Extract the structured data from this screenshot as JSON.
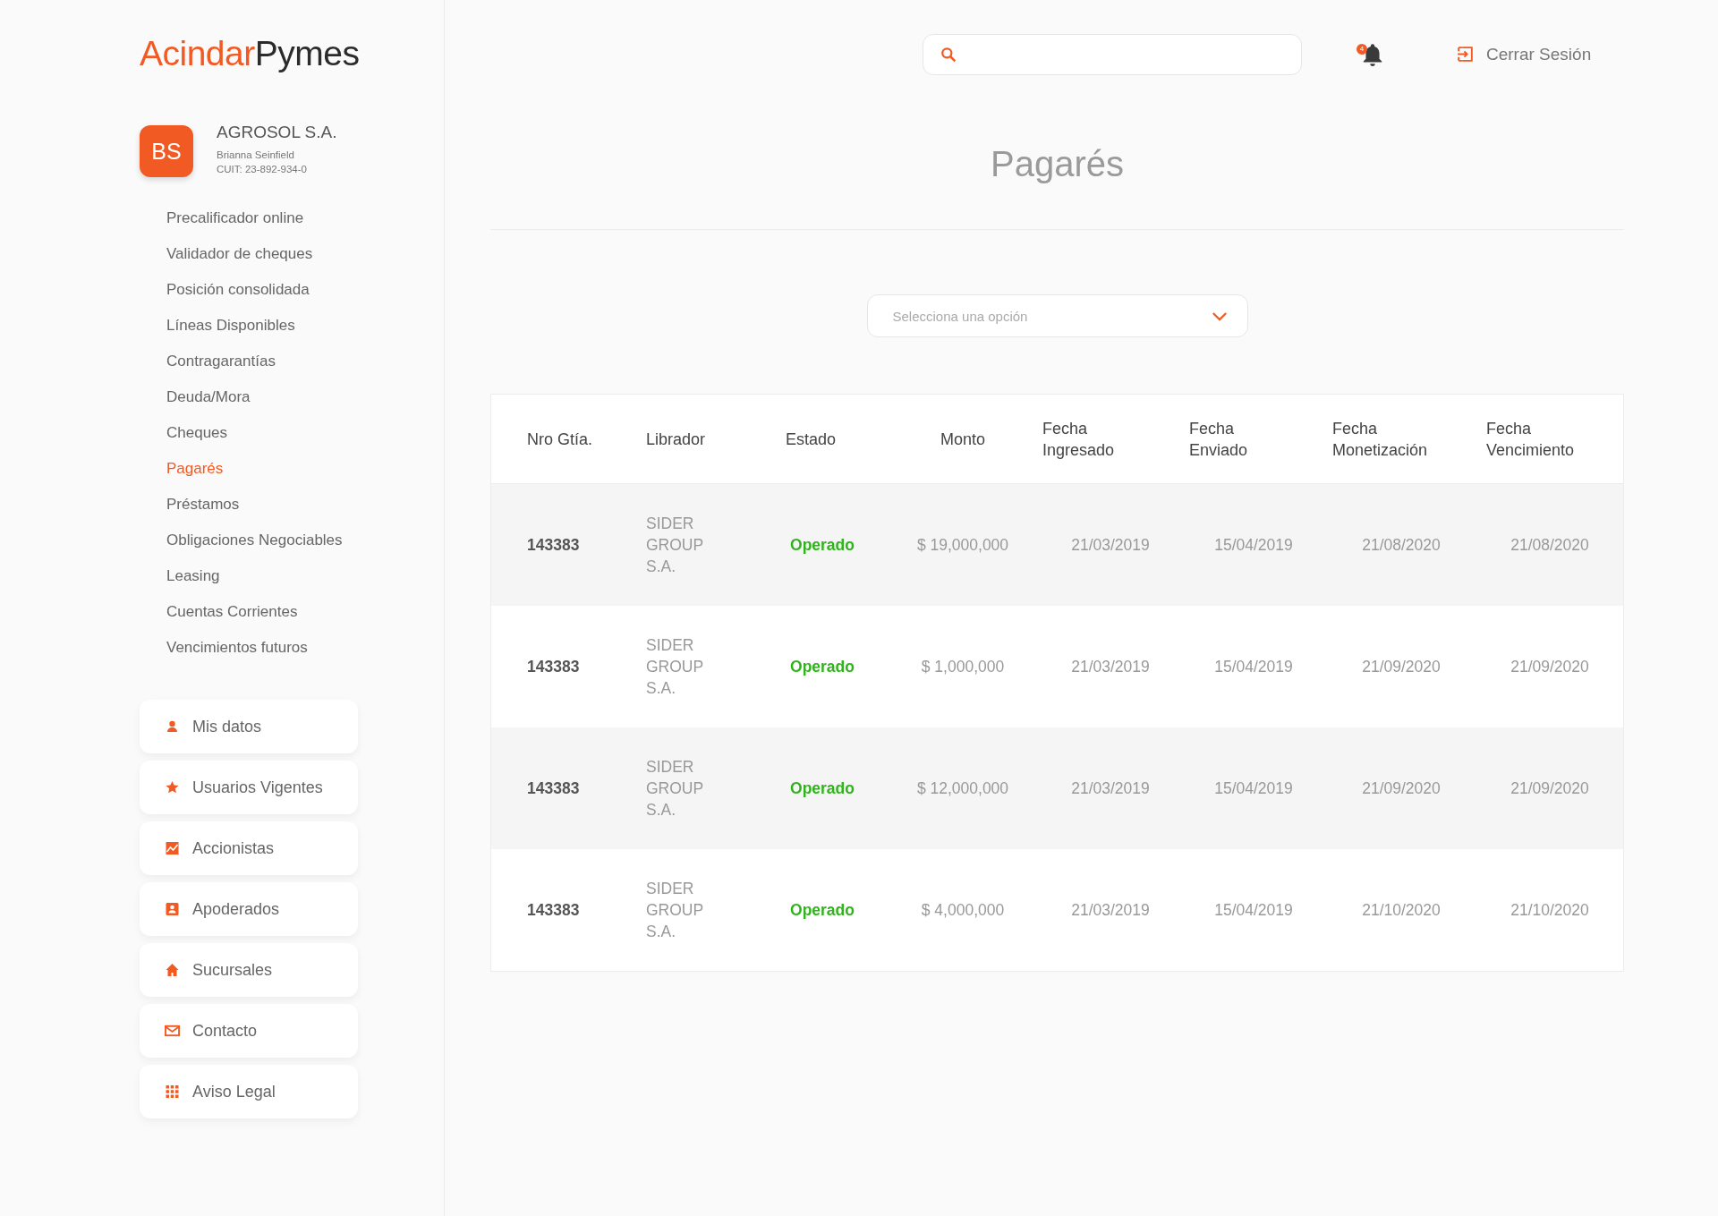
{
  "logo": {
    "part_1": "Acindar",
    "part_2": "Pymes"
  },
  "profile": {
    "initials": "BS",
    "company": "AGROSOL S.A.",
    "user": "Brianna Seinfield",
    "cuit": "CUIT: 23-892-934-0"
  },
  "nav": [
    {
      "label": "Precalificador online",
      "selected": false
    },
    {
      "label": "Validador de cheques",
      "selected": false
    },
    {
      "label": "Posición consolidada",
      "selected": false
    },
    {
      "label": "Líneas Disponibles",
      "selected": false
    },
    {
      "label": "Contragarantías",
      "selected": false
    },
    {
      "label": "Deuda/Mora",
      "selected": false
    },
    {
      "label": "Cheques",
      "selected": false
    },
    {
      "label": "Pagarés",
      "selected": true
    },
    {
      "label": "Préstamos",
      "selected": false
    },
    {
      "label": "Obligaciones Negociables",
      "selected": false
    },
    {
      "label": "Leasing",
      "selected": false
    },
    {
      "label": "Cuentas Corrientes",
      "selected": false
    },
    {
      "label": "Vencimientos futuros",
      "selected": false
    }
  ],
  "shortcuts": [
    {
      "label": "Mis datos",
      "kind": "person"
    },
    {
      "label": "Usuarios Vigentes",
      "kind": "star"
    },
    {
      "label": "Accionistas",
      "kind": "chart"
    },
    {
      "label": "Apoderados",
      "kind": "badge"
    },
    {
      "label": "Sucursales",
      "kind": "home"
    },
    {
      "label": "Contacto",
      "kind": "mail"
    },
    {
      "label": "Aviso Legal",
      "kind": "grid"
    }
  ],
  "topbar": {
    "notification_count": "4",
    "logout": "Cerrar Sesión"
  },
  "page_title": "Pagarés",
  "filter": {
    "placeholder": "Selecciona una opción"
  },
  "table": {
    "columns": [
      [
        "Nro Gtía."
      ],
      [
        "Librador"
      ],
      [
        "Estado"
      ],
      [
        "Monto"
      ],
      [
        "Fecha",
        "Ingresado"
      ],
      [
        "Fecha",
        "Enviado"
      ],
      [
        "Fecha",
        "Monetización"
      ],
      [
        "Fecha",
        "Vencimiento"
      ]
    ],
    "rows": [
      {
        "number": "143383",
        "drawer": "SIDER GROUP S.A.",
        "status": "Operado",
        "amount": "$ 19,000,000",
        "entered": "21/03/2019",
        "sent": "15/04/2019",
        "monetized": "21/08/2020",
        "due": "21/08/2020"
      },
      {
        "number": "143383",
        "drawer": "SIDER GROUP S.A.",
        "status": "Operado",
        "amount": "$ 1,000,000",
        "entered": "21/03/2019",
        "sent": "15/04/2019",
        "monetized": "21/09/2020",
        "due": "21/09/2020"
      },
      {
        "number": "143383",
        "drawer": "SIDER GROUP S.A.",
        "status": "Operado",
        "amount": "$ 12,000,000",
        "entered": "21/03/2019",
        "sent": "15/04/2019",
        "monetized": "21/09/2020",
        "due": "21/09/2020"
      },
      {
        "number": "143383",
        "drawer": "SIDER GROUP S.A.",
        "status": "Operado",
        "amount": "$ 4,000,000",
        "entered": "21/03/2019",
        "sent": "15/04/2019",
        "monetized": "21/10/2020",
        "due": "21/10/2020"
      }
    ]
  }
}
